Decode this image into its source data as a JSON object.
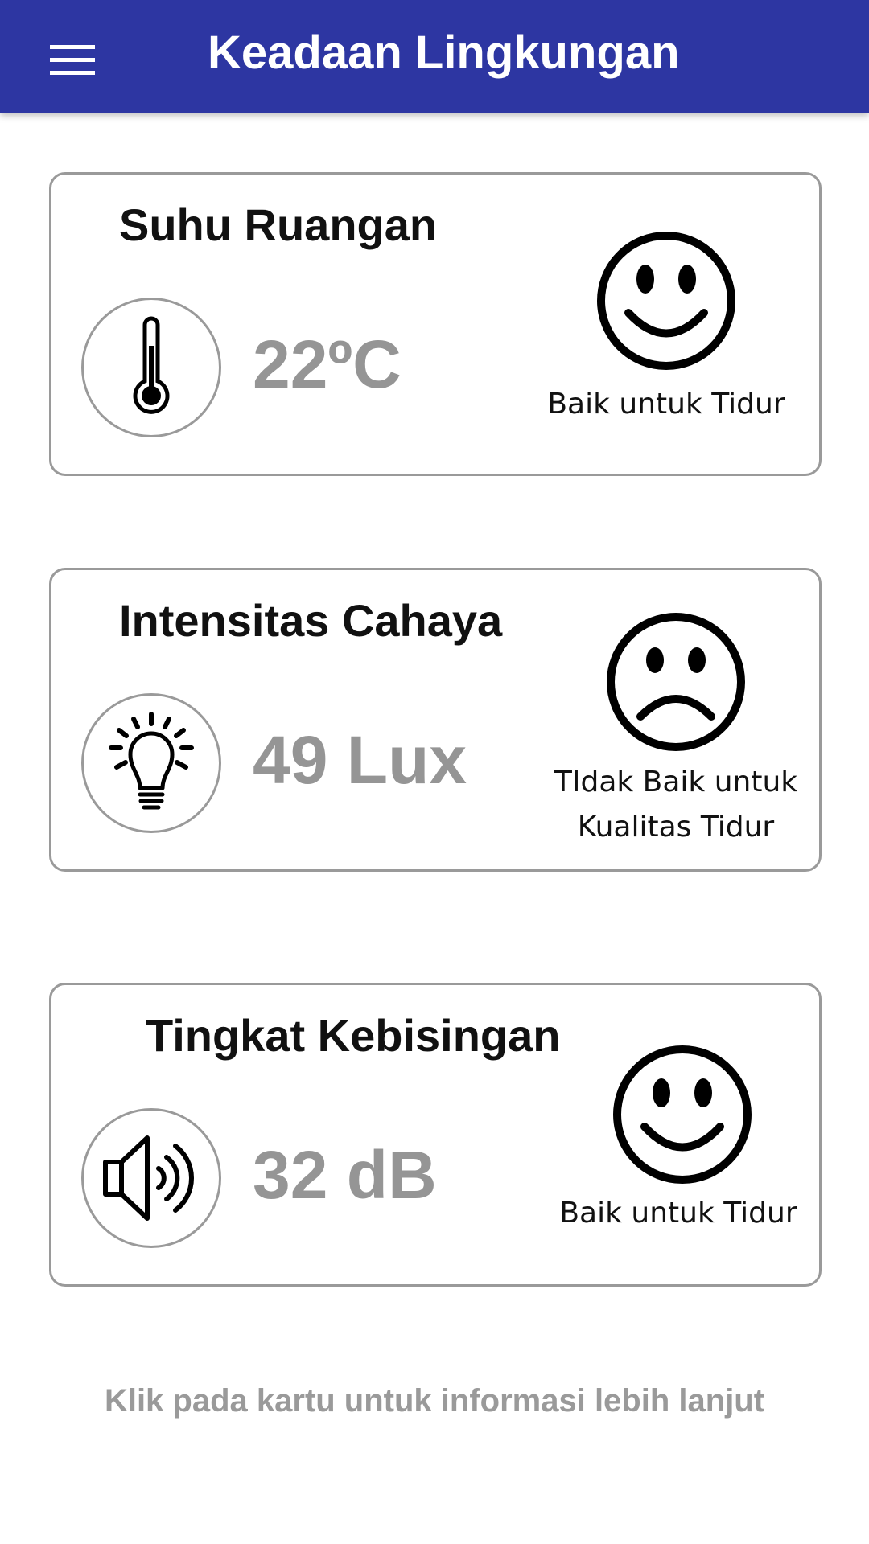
{
  "header": {
    "title": "Keadaan Lingkungan",
    "menu_icon": "hamburger-menu-icon",
    "background_color": "#2d36a2"
  },
  "cards": [
    {
      "title": "Suhu Ruangan",
      "icon": "thermometer-icon",
      "value": "22ºC",
      "status_icon": "smiley-happy-icon",
      "status": "Baik untuk Tidur"
    },
    {
      "title": "Intensitas Cahaya",
      "icon": "light-bulb-icon",
      "value": "49 Lux",
      "status_icon": "smiley-sad-icon",
      "status_line1": "TIdak Baik untuk",
      "status_line2": "Kualitas Tidur"
    },
    {
      "title": "Tingkat Kebisingan",
      "icon": "speaker-volume-icon",
      "value": "32 dB",
      "status_icon": "smiley-happy-icon",
      "status": "Baik untuk Tidur"
    }
  ],
  "footer": {
    "hint": "Klik pada kartu untuk informasi lebih lanjut"
  },
  "colors": {
    "value_text": "#959595",
    "card_border": "#9a9a9a",
    "hint_text": "#9a9a9a"
  }
}
